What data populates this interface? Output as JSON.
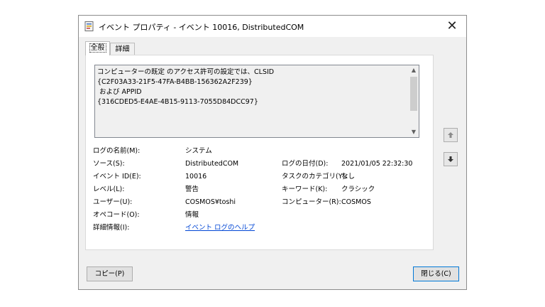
{
  "window": {
    "title": "イベント プロパティ - イベント 10016, DistributedCOM",
    "close_glyph": "✕"
  },
  "tabs": [
    {
      "label": "全般"
    },
    {
      "label": "詳細"
    }
  ],
  "description": {
    "text": "コンピューターの既定 のアクセス許可の設定では、CLSID\n{C2F03A33-21F5-47FA-B4BB-156362A2F239}\n および APPID\n{316CDED5-E4AE-4B15-9113-7055D84DCC97}"
  },
  "properties": {
    "log_name": {
      "label": "ログの名前(M):",
      "value": "システム"
    },
    "source": {
      "label": "ソース(S):",
      "value": "DistributedCOM"
    },
    "logged": {
      "label": "ログの日付(D):",
      "value": "2021/01/05 22:32:30"
    },
    "event_id": {
      "label": "イベント ID(E):",
      "value": "10016"
    },
    "task_category": {
      "label": "タスクのカテゴリ(Y):",
      "value": "なし"
    },
    "level": {
      "label": "レベル(L):",
      "value": "警告"
    },
    "keywords": {
      "label": "キーワード(K):",
      "value": "クラシック"
    },
    "user": {
      "label": "ユーザー(U):",
      "value": "COSMOS¥toshi"
    },
    "computer": {
      "label": "コンピューター(R):",
      "value": "COSMOS"
    },
    "opcode": {
      "label": "オペコード(O):",
      "value": "情報"
    },
    "more_info": {
      "label": "詳細情報(I):",
      "value": "イベント ログのヘルプ"
    }
  },
  "buttons": {
    "copy": "コピー(P)",
    "close": "閉じる(C)"
  }
}
